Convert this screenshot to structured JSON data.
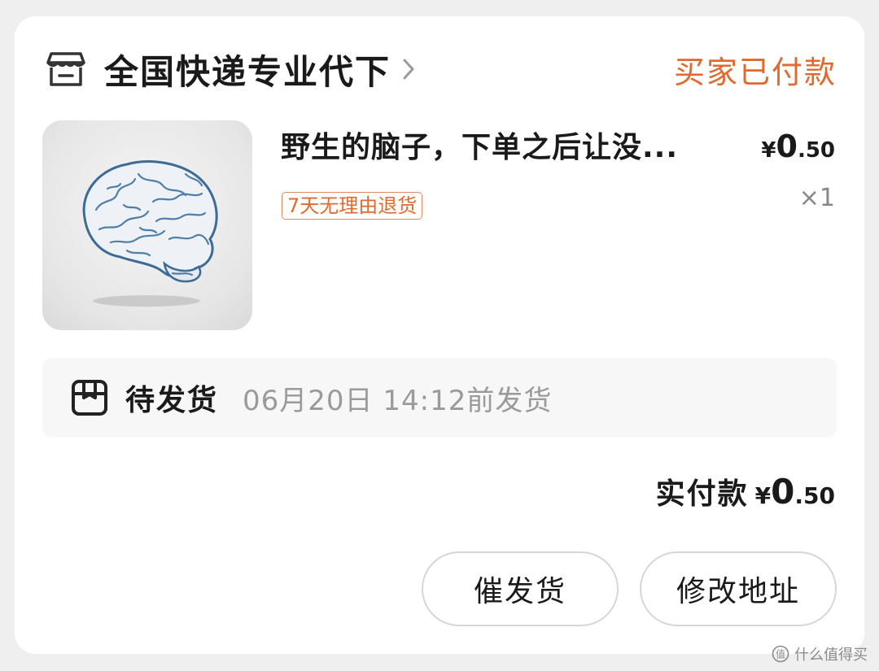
{
  "store": {
    "name": "全国快递专业代下",
    "status": "买家已付款"
  },
  "product": {
    "title": "野生的脑子，下单之后让没...",
    "price_currency": "¥",
    "price_int": "0",
    "price_dec": ".50",
    "return_tag": "7天无理由退货",
    "quantity": "×1",
    "image_icon": "brain-icon"
  },
  "shipping": {
    "status": "待发货",
    "deadline": "06月20日 14:12前发货"
  },
  "total": {
    "label": "实付款",
    "currency": "¥",
    "int": "0",
    "dec": ".50"
  },
  "actions": {
    "urge_label": "催发货",
    "address_label": "修改地址"
  },
  "watermark": {
    "text": "什么值得买"
  },
  "colors": {
    "accent": "#e0692e",
    "background": "#efefef",
    "card": "#ffffff"
  }
}
